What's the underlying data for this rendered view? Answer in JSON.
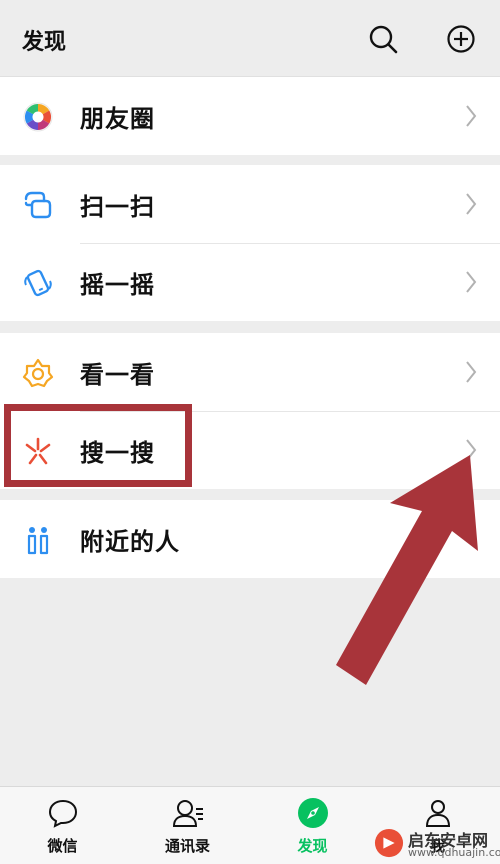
{
  "header": {
    "title": "发现"
  },
  "sections": [
    {
      "items": [
        {
          "label": "朋友圈",
          "icon": "moments-icon"
        }
      ]
    },
    {
      "items": [
        {
          "label": "扫一扫",
          "icon": "scan-icon"
        },
        {
          "label": "摇一摇",
          "icon": "shake-icon"
        }
      ]
    },
    {
      "items": [
        {
          "label": "看一看",
          "icon": "top-stories-icon"
        },
        {
          "label": "搜一搜",
          "icon": "search-icon"
        }
      ]
    },
    {
      "items": [
        {
          "label": "附近的人",
          "icon": "people-nearby-icon"
        }
      ]
    }
  ],
  "tabbar": {
    "tabs": [
      {
        "label": "微信",
        "icon": "chat-bubble-icon",
        "active": false
      },
      {
        "label": "通讯录",
        "icon": "contacts-icon",
        "active": false
      },
      {
        "label": "发现",
        "icon": "compass-icon",
        "active": true
      },
      {
        "label": "我",
        "icon": "person-icon",
        "active": false
      }
    ]
  },
  "watermark": {
    "text": "启东安卓网",
    "url": "www.qdhuajin.com"
  },
  "colors": {
    "accent": "#07c160",
    "annotation": "#a8343a",
    "background": "#ededed"
  }
}
